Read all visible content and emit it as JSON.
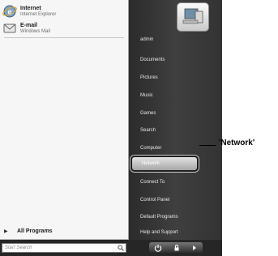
{
  "left_panel": {
    "pinned": [
      {
        "title": "Internet",
        "subtitle": "Internet Explorer",
        "icon": "internet-explorer-icon"
      },
      {
        "title": "E-mail",
        "subtitle": "Windows Mail",
        "icon": "windows-mail-icon"
      }
    ],
    "all_programs": {
      "arrow": "▶",
      "label": "All Programs"
    }
  },
  "right_panel": {
    "items": [
      {
        "label": "admin"
      },
      {
        "label": "Documents"
      },
      {
        "label": "Pictures"
      },
      {
        "label": "Music"
      },
      {
        "label": "Games"
      },
      {
        "label": "Search"
      },
      {
        "label": "Computer"
      },
      {
        "label": "Network",
        "highlighted": true
      },
      {
        "label": "Connect To"
      },
      {
        "label": "Control Panel"
      },
      {
        "label": "Default Programs"
      },
      {
        "label": "Help and Support"
      }
    ]
  },
  "bottom_bar": {
    "search_placeholder": "Start Search"
  },
  "annotation": {
    "label": "'Network'"
  }
}
